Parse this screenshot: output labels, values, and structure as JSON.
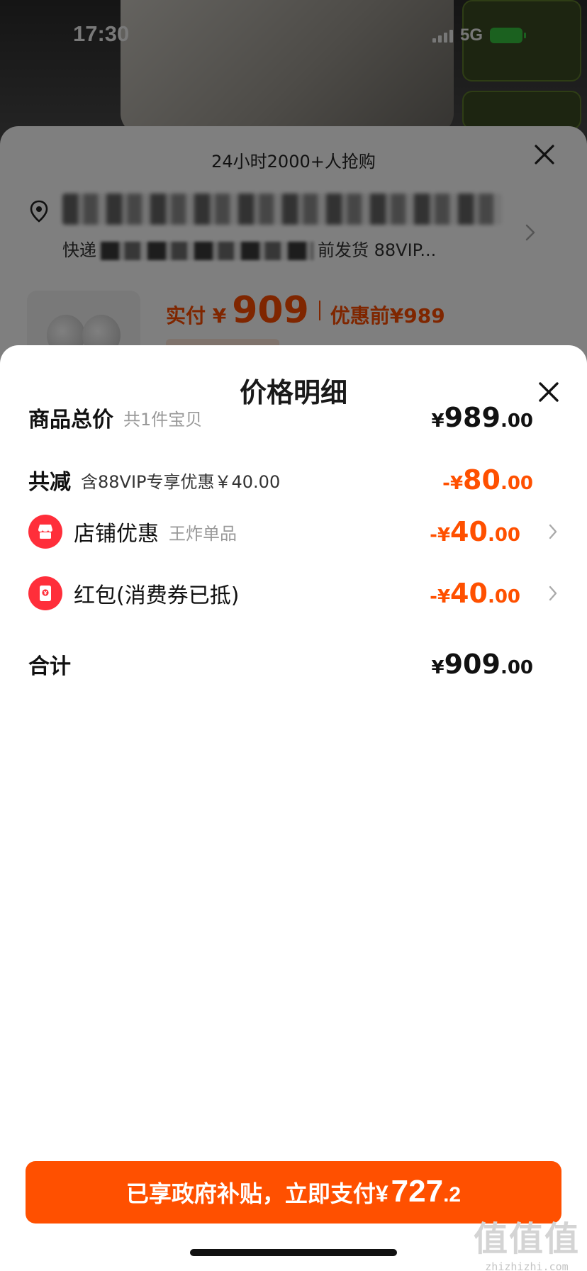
{
  "status_bar": {
    "time": "17:30",
    "network": "5G"
  },
  "order_sheet": {
    "header": "24小时2000+人抢购",
    "address_prefix": "快递",
    "address_suffix": "前发货 88VIP...",
    "actual_pay_label": "实付 ¥",
    "actual_pay_amount": "909",
    "before_discount": "优惠前¥989"
  },
  "detail": {
    "title": "价格明细",
    "rows": [
      {
        "label": "商品总价",
        "note": "共1件宝贝",
        "sign": "¥",
        "major": "989",
        "minor": ".00"
      },
      {
        "label": "共减",
        "note": "含88VIP专享优惠￥40.00",
        "sign": "-¥",
        "major": "80",
        "minor": ".00"
      },
      {
        "label": "店铺优惠",
        "note": "王炸单品",
        "sign": "-¥",
        "major": "40",
        "minor": ".00",
        "icon": "store-icon"
      },
      {
        "label": "红包(消费券已抵)",
        "note": "",
        "sign": "-¥",
        "major": "40",
        "minor": ".00",
        "icon": "red-packet-icon"
      },
      {
        "label": "合计",
        "note": "",
        "sign": "¥",
        "major": "909",
        "minor": ".00"
      }
    ]
  },
  "pay_button": {
    "text": "已享政府补贴，立即支付",
    "sign": "¥",
    "major": "727",
    "minor": ".2"
  },
  "watermark": {
    "logo": "值值值",
    "url": "zhizhizhi.com"
  },
  "colors": {
    "accent": "#ff5000",
    "icon_red": "#ff2e3a",
    "text_dark": "#111111",
    "text_muted": "#999999"
  },
  "icons": [
    "location-icon",
    "close-icon",
    "chevron-right-icon",
    "store-icon",
    "red-packet-icon",
    "signal-icon",
    "battery-icon"
  ]
}
